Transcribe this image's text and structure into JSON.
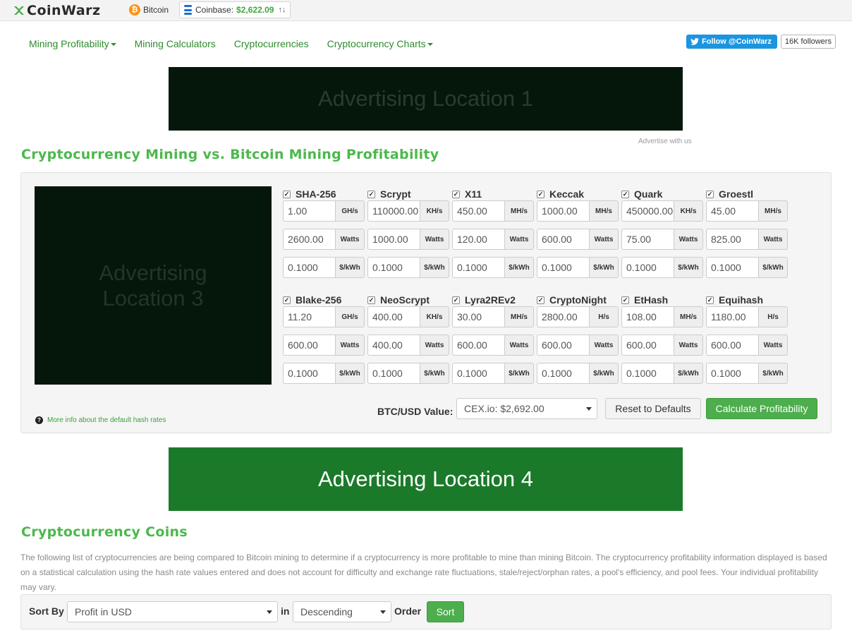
{
  "header": {
    "logo_text": "CoinWarz",
    "bitcoin_label": "Bitcoin",
    "price_source": "Coinbase:",
    "price_value": "$2,622.09",
    "price_arrows": "↑↓"
  },
  "nav": {
    "items": [
      {
        "label": "Mining Profitability",
        "dropdown": true
      },
      {
        "label": "Mining Calculators",
        "dropdown": false
      },
      {
        "label": "Cryptocurrencies",
        "dropdown": false
      },
      {
        "label": "Cryptocurrency Charts",
        "dropdown": true
      }
    ],
    "twitter_follow": "Follow @CoinWarz",
    "twitter_followers": "16K followers"
  },
  "ads": {
    "ad1": "Advertising Location 1",
    "advertise_with_us": "Advertise with us",
    "ad3_line1": "Advertising",
    "ad3_line2": "Location 3",
    "ad4": "Advertising Location 4"
  },
  "calculator": {
    "title": "Cryptocurrency Mining vs. Bitcoin Mining Profitability",
    "algorithms": [
      {
        "name": "SHA-256",
        "checked": true,
        "hash_rate": "1.00",
        "hash_unit": "GH/s",
        "power": "2600.00",
        "power_unit": "Watts",
        "cost": "0.1000",
        "cost_unit": "$/kWh"
      },
      {
        "name": "Scrypt",
        "checked": true,
        "hash_rate": "110000.00",
        "hash_unit": "KH/s",
        "power": "1000.00",
        "power_unit": "Watts",
        "cost": "0.1000",
        "cost_unit": "$/kWh"
      },
      {
        "name": "X11",
        "checked": true,
        "hash_rate": "450.00",
        "hash_unit": "MH/s",
        "power": "120.00",
        "power_unit": "Watts",
        "cost": "0.1000",
        "cost_unit": "$/kWh"
      },
      {
        "name": "Keccak",
        "checked": true,
        "hash_rate": "1000.00",
        "hash_unit": "MH/s",
        "power": "600.00",
        "power_unit": "Watts",
        "cost": "0.1000",
        "cost_unit": "$/kWh"
      },
      {
        "name": "Quark",
        "checked": true,
        "hash_rate": "450000.00",
        "hash_unit": "KH/s",
        "power": "75.00",
        "power_unit": "Watts",
        "cost": "0.1000",
        "cost_unit": "$/kWh"
      },
      {
        "name": "Groestl",
        "checked": true,
        "hash_rate": "45.00",
        "hash_unit": "MH/s",
        "power": "825.00",
        "power_unit": "Watts",
        "cost": "0.1000",
        "cost_unit": "$/kWh"
      },
      {
        "name": "Blake-256",
        "checked": true,
        "hash_rate": "11.20",
        "hash_unit": "GH/s",
        "power": "600.00",
        "power_unit": "Watts",
        "cost": "0.1000",
        "cost_unit": "$/kWh"
      },
      {
        "name": "NeoScrypt",
        "checked": true,
        "hash_rate": "400.00",
        "hash_unit": "KH/s",
        "power": "400.00",
        "power_unit": "Watts",
        "cost": "0.1000",
        "cost_unit": "$/kWh"
      },
      {
        "name": "Lyra2REv2",
        "checked": true,
        "hash_rate": "30.00",
        "hash_unit": "MH/s",
        "power": "600.00",
        "power_unit": "Watts",
        "cost": "0.1000",
        "cost_unit": "$/kWh"
      },
      {
        "name": "CryptoNight",
        "checked": true,
        "hash_rate": "2800.00",
        "hash_unit": "H/s",
        "power": "600.00",
        "power_unit": "Watts",
        "cost": "0.1000",
        "cost_unit": "$/kWh"
      },
      {
        "name": "EtHash",
        "checked": true,
        "hash_rate": "108.00",
        "hash_unit": "MH/s",
        "power": "600.00",
        "power_unit": "Watts",
        "cost": "0.1000",
        "cost_unit": "$/kWh"
      },
      {
        "name": "Equihash",
        "checked": true,
        "hash_rate": "1180.00",
        "hash_unit": "H/s",
        "power": "600.00",
        "power_unit": "Watts",
        "cost": "0.1000",
        "cost_unit": "$/kWh"
      }
    ],
    "btc_usd_label": "BTC/USD Value:",
    "btc_usd_selected": "CEX.io: $2,692.00",
    "reset_label": "Reset to Defaults",
    "calculate_label": "Calculate Profitability",
    "more_info": "More info about the default hash rates"
  },
  "coins": {
    "title": "Cryptocurrency Coins",
    "description": "The following list of cryptocurrencies are being compared to Bitcoin mining to determine if a cryptocurrency is more profitable to mine than mining Bitcoin. The cryptocurrency profitability information displayed is based on a statistical calculation using the hash rate values entered and does not account for difficulty and exchange rate fluctuations, stale/reject/orphan rates, a pool's efficiency, and pool fees. Your individual profitability may vary.",
    "sort_by_label": "Sort By",
    "sort_by_selected": "Profit in USD",
    "in_label": "in",
    "order_selected": "Descending",
    "order_label": "Order",
    "sort_button": "Sort"
  },
  "colors": {
    "accent_green": "#4cb84c",
    "nav_green": "#2e8b2e",
    "price_green": "#3fa83f",
    "bitcoin_orange": "#f7931a",
    "twitter_blue": "#1b95e0"
  },
  "icons": [
    "coinwarz-logo-icon",
    "bitcoin-icon",
    "coin-stack-icon",
    "twitter-bird-icon",
    "checkbox-checked-icon",
    "question-icon",
    "chevron-down-icon"
  ]
}
